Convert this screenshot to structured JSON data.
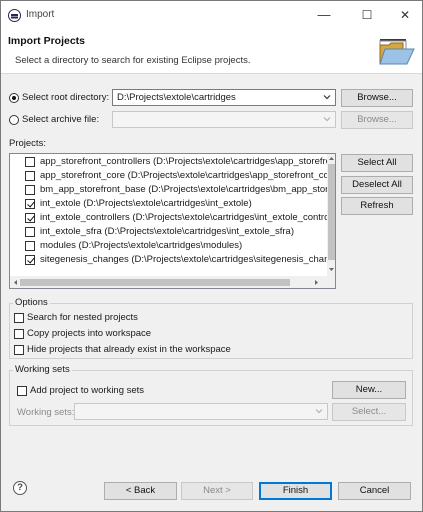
{
  "window": {
    "title": "Import",
    "minimize_glyph": "—",
    "maximize_glyph": "☐",
    "close_glyph": "✕"
  },
  "banner": {
    "title": "Import Projects",
    "description": "Select a directory to search for existing Eclipse projects."
  },
  "source": {
    "root_dir_label": "Select root directory:",
    "root_dir_value": "D:\\Projects\\extole\\cartridges",
    "archive_label": "Select archive file:",
    "archive_value": "",
    "browse_label": "Browse...",
    "browse_archive_label": "Browse..."
  },
  "projects": {
    "label": "Projects:",
    "items": [
      {
        "name": "app_storefront_controllers (D:\\Projects\\extole\\cartridges\\app_storefront_controllers)",
        "checked": false
      },
      {
        "name": "app_storefront_core (D:\\Projects\\extole\\cartridges\\app_storefront_core)",
        "checked": false
      },
      {
        "name": "bm_app_storefront_base (D:\\Projects\\extole\\cartridges\\bm_app_storefront_base)",
        "checked": false
      },
      {
        "name": "int_extole (D:\\Projects\\extole\\cartridges\\int_extole)",
        "checked": true
      },
      {
        "name": "int_extole_controllers (D:\\Projects\\extole\\cartridges\\int_extole_controllers)",
        "checked": true
      },
      {
        "name": "int_extole_sfra (D:\\Projects\\extole\\cartridges\\int_extole_sfra)",
        "checked": false
      },
      {
        "name": "modules (D:\\Projects\\extole\\cartridges\\modules)",
        "checked": false
      },
      {
        "name": "sitegenesis_changes (D:\\Projects\\extole\\cartridges\\sitegenesis_changes)",
        "checked": true
      }
    ],
    "select_all_label": "Select All",
    "deselect_all_label": "Deselect All",
    "refresh_label": "Refresh"
  },
  "options": {
    "title": "Options",
    "search_nested": "Search for nested projects",
    "copy_projects": "Copy projects into workspace",
    "hide_existing": "Hide projects that already exist in the workspace"
  },
  "working_sets": {
    "title": "Working sets",
    "add_label": "Add project to working sets",
    "sets_label": "Working sets:",
    "sets_value": "",
    "new_label": "New...",
    "select_label": "Select..."
  },
  "footer": {
    "help_glyph": "?",
    "back_label": "< Back",
    "next_label": "Next >",
    "finish_label": "Finish",
    "cancel_label": "Cancel"
  }
}
